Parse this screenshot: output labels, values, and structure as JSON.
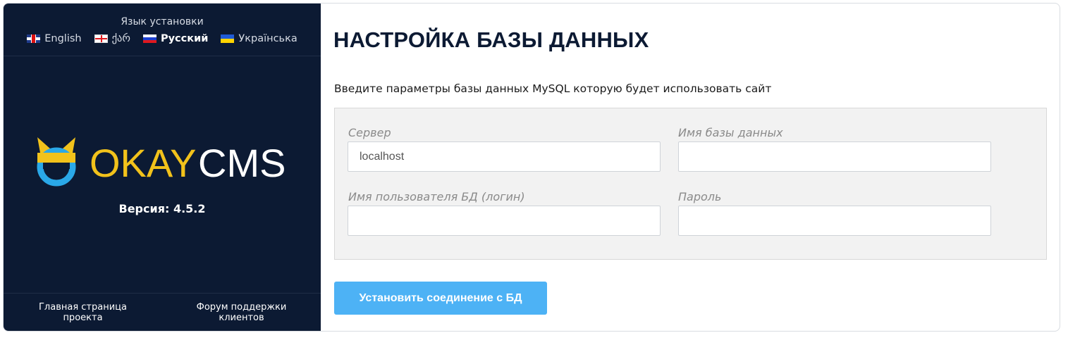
{
  "sidebar": {
    "lang_title": "Язык установки",
    "languages": [
      {
        "label": "English",
        "flag": "uk-flag-icon",
        "active": false
      },
      {
        "label": "ქარ",
        "flag": "georgia-flag-icon",
        "active": false
      },
      {
        "label": "Русский",
        "flag": "russia-flag-icon",
        "active": true
      },
      {
        "label": "Українська",
        "flag": "ukraine-flag-icon",
        "active": false
      }
    ],
    "logo": {
      "part1": "OKAY",
      "part2": "CMS"
    },
    "version": "Версия: 4.5.2",
    "footer_links": [
      {
        "label": "Главная страница проекта"
      },
      {
        "label": "Форум поддержки клиентов"
      }
    ]
  },
  "main": {
    "title": "НАСТРОЙКА БАЗЫ ДАННЫХ",
    "subtitle": "Введите параметры базы данных MySQL которую будет использовать сайт",
    "fields": {
      "server": {
        "label": "Сервер",
        "value": "localhost"
      },
      "dbname": {
        "label": "Имя базы данных",
        "value": ""
      },
      "user": {
        "label": "Имя пользователя БД (логин)",
        "value": ""
      },
      "password": {
        "label": "Пароль",
        "value": ""
      }
    },
    "connect_button": "Установить соединение с БД"
  },
  "colors": {
    "sidebar_bg": "#0c1a33",
    "accent": "#4db2f5",
    "logo_yellow": "#f2c21b",
    "logo_blue": "#2aa8e8"
  }
}
